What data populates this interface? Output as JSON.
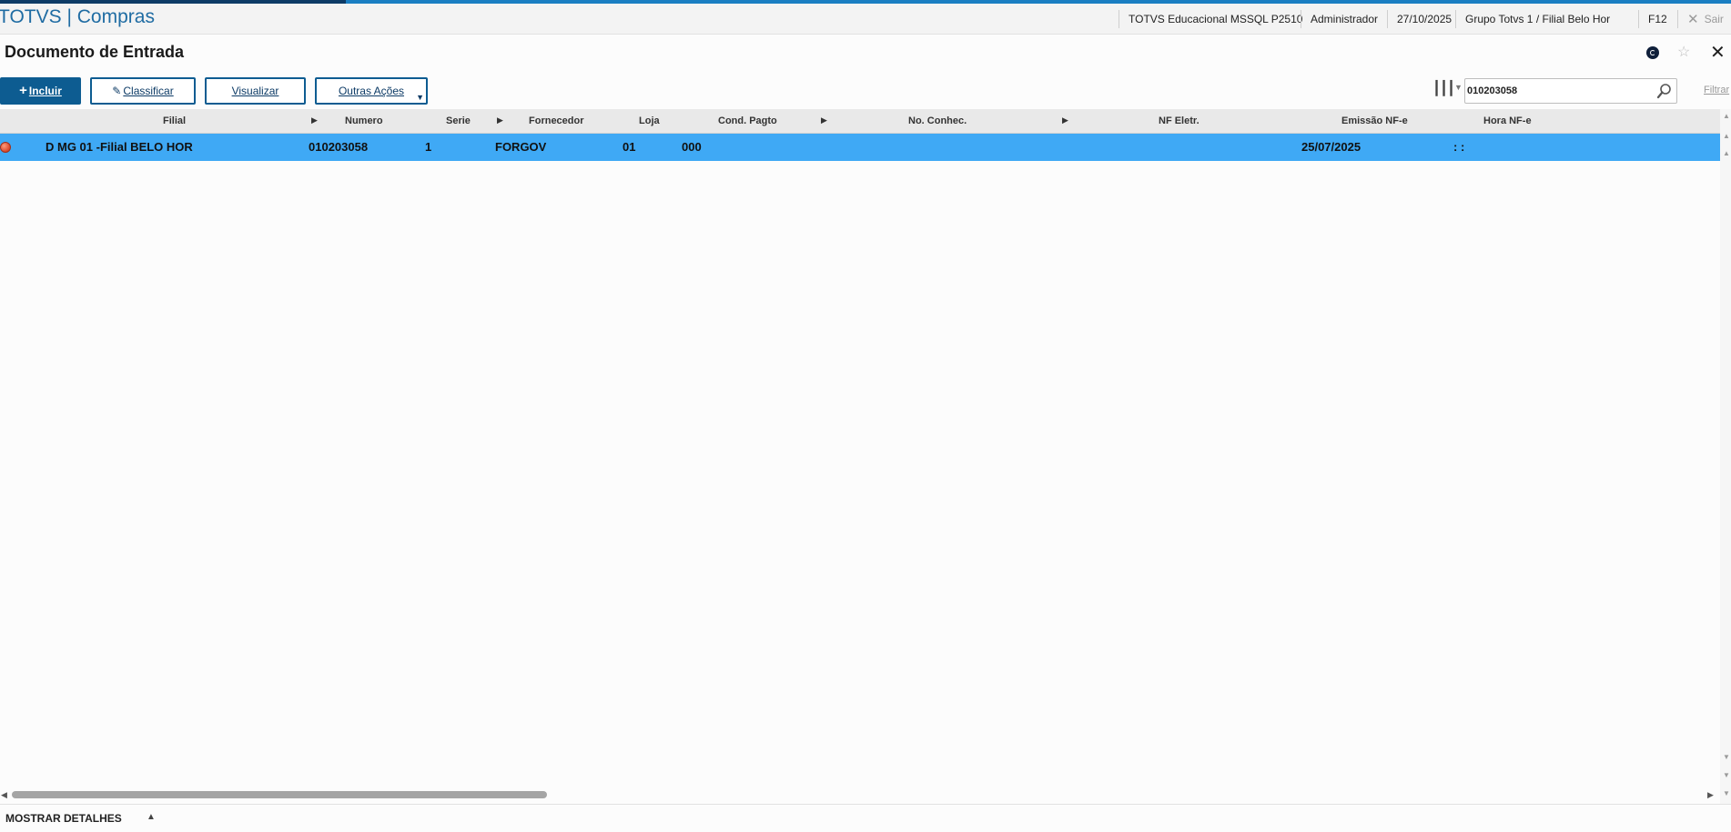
{
  "header": {
    "app_title": "TOTVS | Compras",
    "environment": "TOTVS Educacional MSSQL P2510",
    "user": "Administrador",
    "date": "27/10/2025",
    "company": "Grupo Totvs 1 / Filial Belo Hor",
    "f12": "F12",
    "exit_label": "Sair"
  },
  "page": {
    "title": "Documento de Entrada"
  },
  "toolbar": {
    "incluir": "Incluir",
    "classificar": "Classificar",
    "visualizar": "Visualizar",
    "outras_acoes": "Outras Ações",
    "search_value": "010203058",
    "filter_label": "Filtrar"
  },
  "grid": {
    "columns": [
      "Filial",
      "Numero",
      "Serie",
      "Fornecedor",
      "Loja",
      "Cond. Pagto",
      "No. Conhec.",
      "NF Eletr.",
      "Emissão NF-e",
      "Hora NF-e"
    ],
    "rows": [
      {
        "status_color": "#e0522f",
        "filial": "D MG 01 -Filial BELO HOR",
        "numero": "010203058",
        "serie": "1",
        "fornecedor": "FORGOV",
        "loja": "01",
        "cond_pagto": "000",
        "no_conhec": "",
        "nf_eletr": "",
        "emissao_nfe": "25/07/2025",
        "hora_nfe": ": :"
      }
    ],
    "selected_row_color": "#3fa9f5"
  },
  "footer": {
    "details_label": "MOSTRAR DETALHES"
  },
  "colors": {
    "brand": "#1f6ca3",
    "primary_button": "#0d5c91",
    "selection": "#3fa9f5"
  }
}
